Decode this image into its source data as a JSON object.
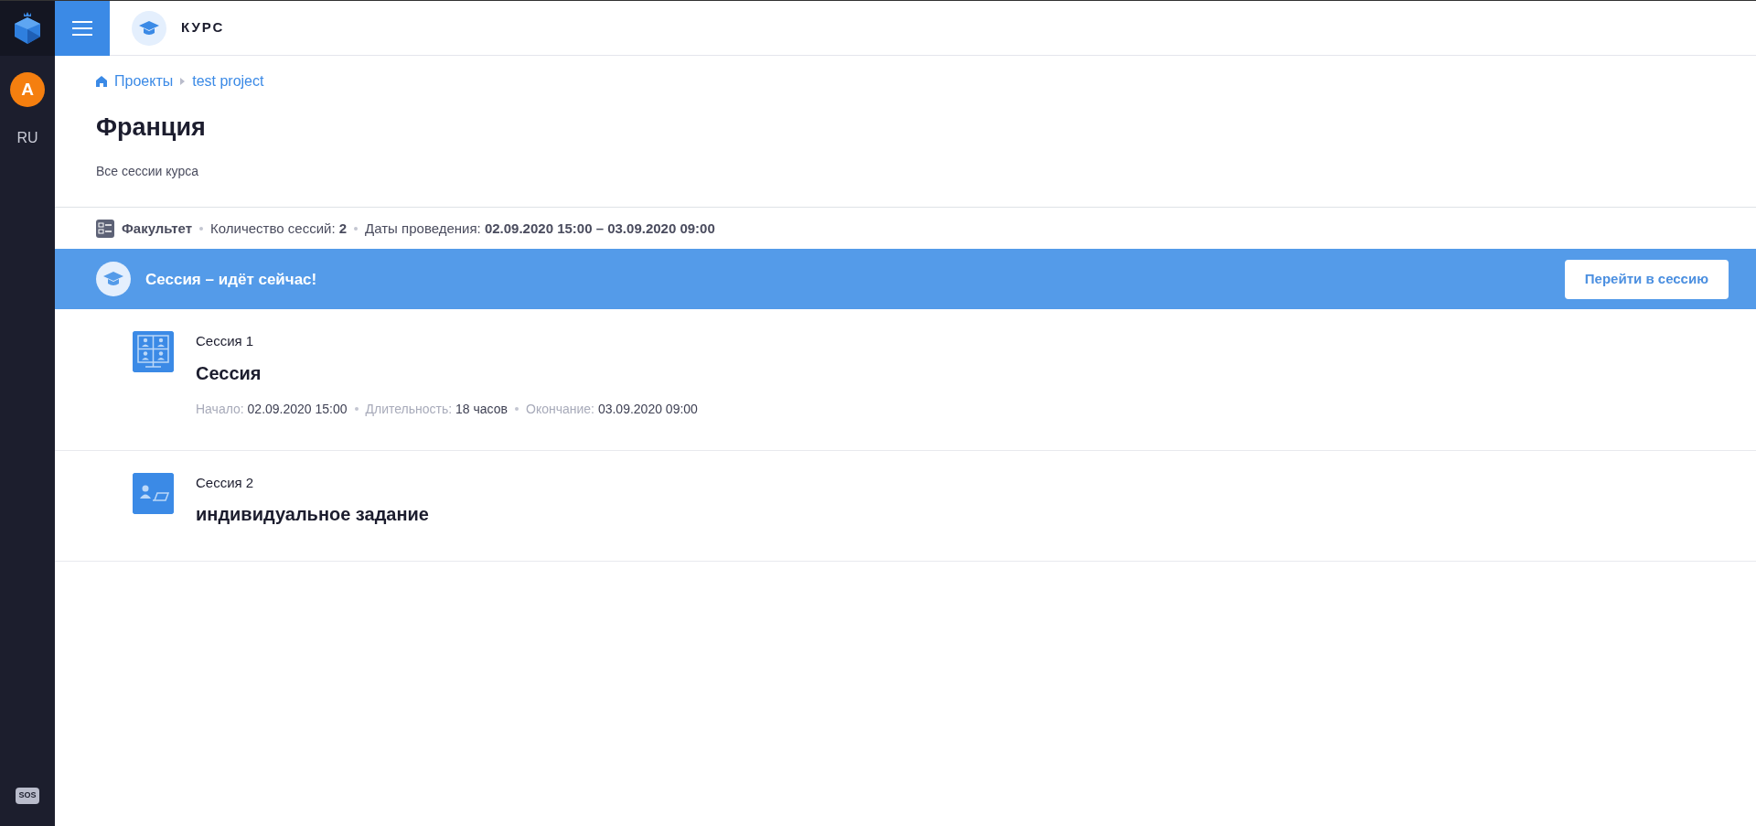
{
  "sidebar": {
    "avatar_letter": "A",
    "language": "RU",
    "help_badge": "SOS"
  },
  "header": {
    "title": "КУРС"
  },
  "breadcrumbs": [
    "Проекты",
    "test project"
  ],
  "page": {
    "title": "Франция",
    "subtitle": "Все сессии курса"
  },
  "meta": {
    "category": "Факультет",
    "items": [
      {
        "label": "Количество сессий:",
        "value": "2"
      },
      {
        "label": "Даты проведения:",
        "value": "02.09.2020 15:00 – 03.09.2020 09:00"
      }
    ]
  },
  "banner": {
    "text": "Сессия – идёт сейчас!",
    "button": "Перейти в сессию"
  },
  "sessions": [
    {
      "kind": "group",
      "number": "Сессия 1",
      "title": "Сессия",
      "details": [
        {
          "label": "Начало:",
          "value": "02.09.2020 15:00"
        },
        {
          "label": "Длительность:",
          "value": "18 часов"
        },
        {
          "label": "Окончание:",
          "value": "03.09.2020 09:00"
        }
      ]
    },
    {
      "kind": "individual",
      "number": "Сессия 2",
      "title": "индивидуальное задание"
    }
  ]
}
